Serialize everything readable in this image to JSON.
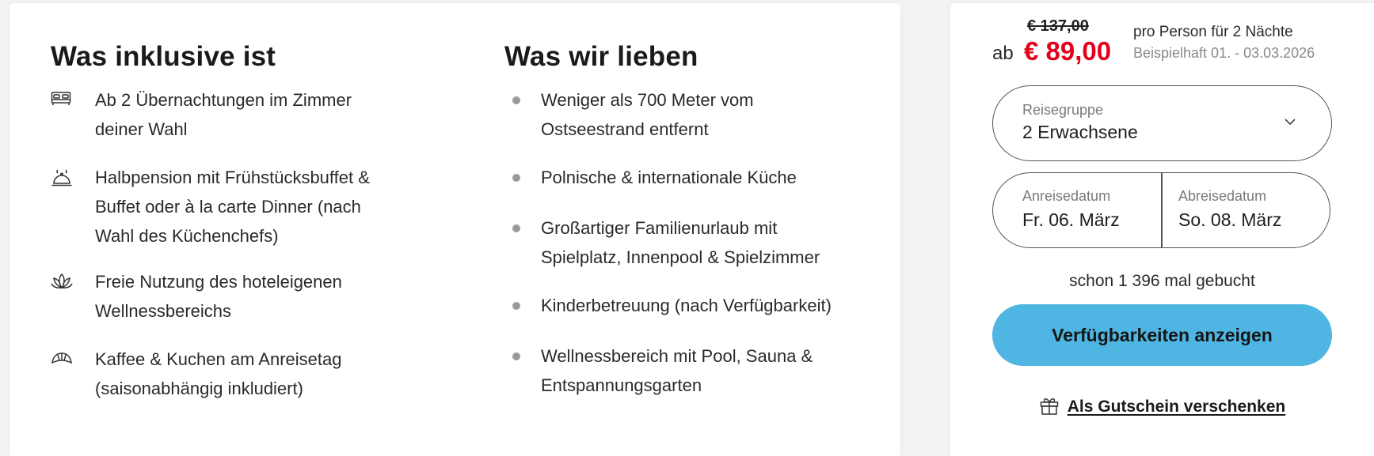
{
  "included": {
    "title": "Was inklusive ist",
    "items": [
      {
        "icon": "bed-icon",
        "line1": "Ab 2 Übernachtungen im Zimmer",
        "line2": "deiner Wahl",
        "line3": ""
      },
      {
        "icon": "dining-cloche-icon",
        "line1": "Halbpension mit Frühstücksbuffet &",
        "line2": "Buffet oder à la carte Dinner (nach",
        "line3": "Wahl des Küchenchefs)"
      },
      {
        "icon": "lotus-icon",
        "line1": "Freie Nutzung des hoteleigenen",
        "line2": "Wellnessbereichs",
        "line3": ""
      },
      {
        "icon": "croissant-icon",
        "line1": "Kaffee & Kuchen am Anreisetag",
        "line2": "(saisonabhängig inkludiert)",
        "line3": ""
      }
    ]
  },
  "loved": {
    "title": "Was wir lieben",
    "items": [
      {
        "line1": "Weniger als 700 Meter vom",
        "line2": "Ostseestrand entfernt"
      },
      {
        "line1": "Polnische & internationale Küche",
        "line2": ""
      },
      {
        "line1": "Großartiger Familienurlaub mit",
        "line2": "Spielplatz, Innenpool & Spielzimmer"
      },
      {
        "line1": "Kinderbetreuung (nach Verfügbarkeit)",
        "line2": ""
      },
      {
        "line1": "Wellnessbereich mit Pool, Sauna &",
        "line2": "Entspannungsgarten"
      }
    ]
  },
  "booking": {
    "old_price": "€ 137,00",
    "prefix": "ab",
    "price": "€ 89,00",
    "per_person": "pro Person für 2 Nächte",
    "example": "Beispielhaft 01. - 03.03.2026",
    "group_label": "Reisegruppe",
    "group_value": "2 Erwachsene",
    "arrival_label": "Anreisedatum",
    "arrival_value": "Fr. 06. März",
    "departure_label": "Abreisedatum",
    "departure_value": "So. 08. März",
    "booked_text": "schon 1 396 mal gebucht",
    "cta_label": "Verfügbarkeiten anzeigen",
    "voucher_label": "Als Gutschein verschenken",
    "cta_color": "#4fb6e3",
    "price_color": "#e3001b"
  }
}
